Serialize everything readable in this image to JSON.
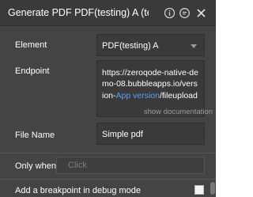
{
  "header": {
    "title": "Generate PDF PDF(testing) A (tes",
    "info_icon": "info-icon",
    "comment_icon": "comment-icon",
    "close_icon": "close-icon"
  },
  "fields": {
    "element": {
      "label": "Element",
      "value": "PDF(testing) A"
    },
    "endpoint": {
      "label": "Endpoint",
      "text_before": "https://zeroqode-native-demo-08.bubbleapps.io/version-",
      "dynamic": "App version",
      "text_after": "/fileupload",
      "doc_link": "show documentation"
    },
    "file_name": {
      "label": "File Name",
      "value": "Simple pdf"
    },
    "only_when": {
      "label": "Only when",
      "placeholder": "Click"
    },
    "breakpoint": {
      "label": "Add a breakpoint in debug mode",
      "checked": false
    }
  },
  "colors": {
    "panel_bg": "#444444",
    "title_bg": "#3a3a3a",
    "dynamic_text": "#5aa0f0"
  }
}
